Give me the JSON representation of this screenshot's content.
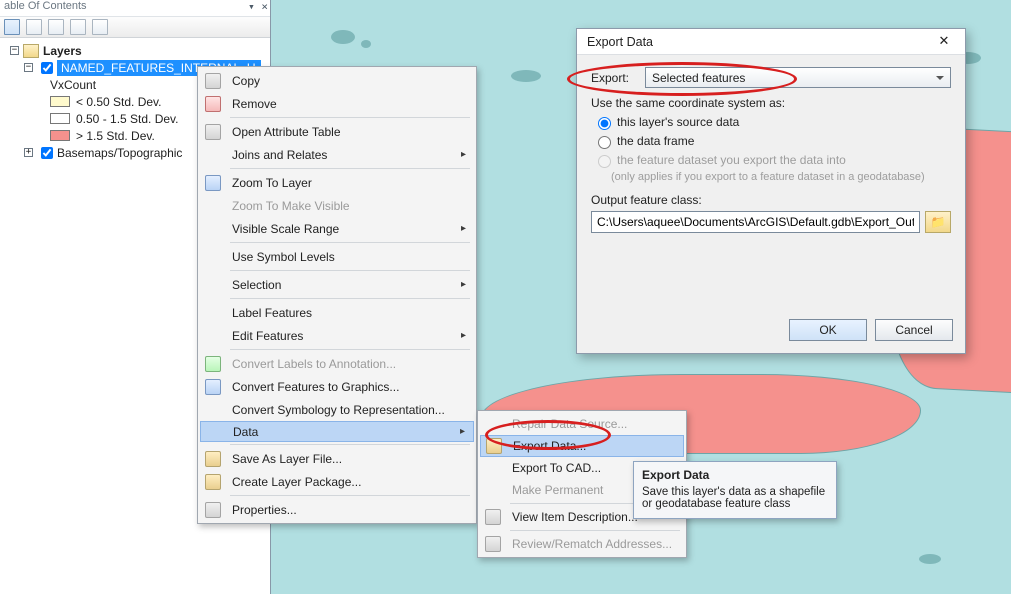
{
  "toc": {
    "title": "able Of Contents",
    "pin_close": "▾ ×",
    "root": "Layers",
    "named_features": "NAMED_FEATURES_INTERNAL_U",
    "vxcount": "VxCount",
    "class_a": "< 0.50 Std. Dev.",
    "class_b": "0.50 - 1.5 Std. Dev.",
    "class_c": "> 1.5 Std. Dev.",
    "basemaps": "Basemaps/Topographic"
  },
  "ctx": {
    "copy": "Copy",
    "remove": "Remove",
    "open_attr": "Open Attribute Table",
    "joins": "Joins and Relates",
    "zoom_layer": "Zoom To Layer",
    "zoom_visible": "Zoom To Make Visible",
    "vis_scale": "Visible Scale Range",
    "symbol_levels": "Use Symbol Levels",
    "selection": "Selection",
    "label_features": "Label Features",
    "edit_features": "Edit Features",
    "conv_labels": "Convert Labels to Annotation...",
    "conv_features": "Convert Features to Graphics...",
    "conv_sym": "Convert Symbology to Representation...",
    "data": "Data",
    "save_as": "Save As Layer File...",
    "layer_pkg": "Create Layer Package...",
    "properties": "Properties..."
  },
  "sub": {
    "repair": "Repair Data Source...",
    "export_data": "Export Data...",
    "export_cad": "Export To CAD...",
    "make_perm": "Make Permanent",
    "view_desc": "View Item Description...",
    "review": "Review/Rematch Addresses..."
  },
  "tooltip": {
    "title": "Export Data",
    "body": "Save this layer's data as a shapefile or geodatabase feature class"
  },
  "dlg": {
    "title": "Export Data",
    "export_label": "Export:",
    "export_value": "Selected features",
    "coord_label": "Use the same coordinate system as:",
    "opt_source": "this layer's source data",
    "opt_frame": "the data frame",
    "opt_feature": "the feature dataset you export the data into",
    "opt_feature_note": "(only applies if you export to a feature dataset in a geodatabase)",
    "output_label": "Output feature class:",
    "output_value": "C:\\Users\\aquee\\Documents\\ArcGIS\\Default.gdb\\Export_Output",
    "ok": "OK",
    "cancel": "Cancel"
  }
}
